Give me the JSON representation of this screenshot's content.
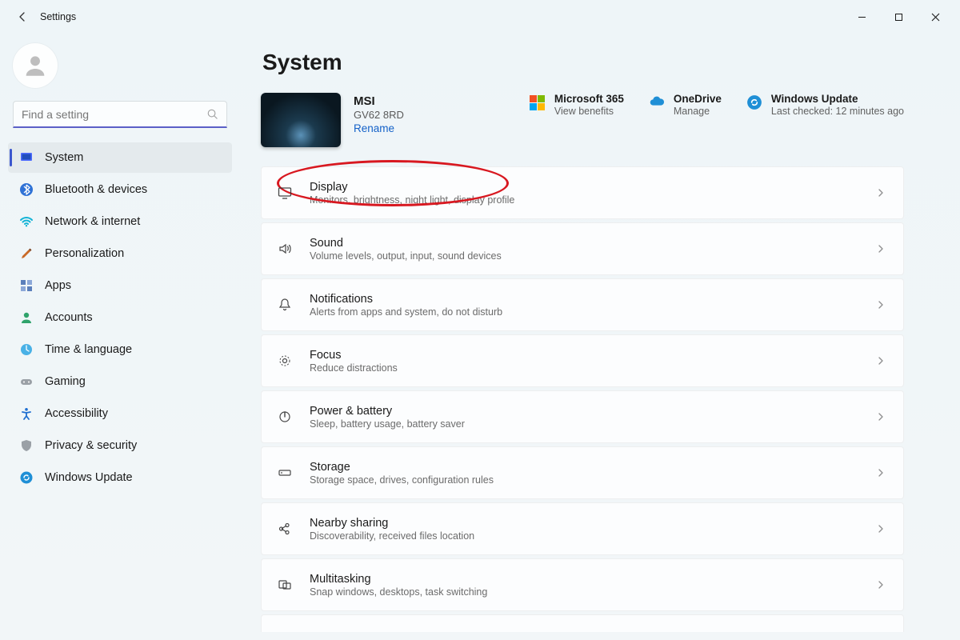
{
  "app_title": "Settings",
  "search": {
    "placeholder": "Find a setting"
  },
  "sidebar": {
    "items": [
      {
        "label": "System"
      },
      {
        "label": "Bluetooth & devices"
      },
      {
        "label": "Network & internet"
      },
      {
        "label": "Personalization"
      },
      {
        "label": "Apps"
      },
      {
        "label": "Accounts"
      },
      {
        "label": "Time & language"
      },
      {
        "label": "Gaming"
      },
      {
        "label": "Accessibility"
      },
      {
        "label": "Privacy & security"
      },
      {
        "label": "Windows Update"
      }
    ]
  },
  "page": {
    "title": "System",
    "device": {
      "name": "MSI",
      "model": "GV62 8RD",
      "rename": "Rename"
    },
    "status": [
      {
        "title": "Microsoft 365",
        "sub": "View benefits"
      },
      {
        "title": "OneDrive",
        "sub": "Manage"
      },
      {
        "title": "Windows Update",
        "sub": "Last checked: 12 minutes ago"
      }
    ],
    "settings": [
      {
        "title": "Display",
        "desc": "Monitors, brightness, night light, display profile"
      },
      {
        "title": "Sound",
        "desc": "Volume levels, output, input, sound devices"
      },
      {
        "title": "Notifications",
        "desc": "Alerts from apps and system, do not disturb"
      },
      {
        "title": "Focus",
        "desc": "Reduce distractions"
      },
      {
        "title": "Power & battery",
        "desc": "Sleep, battery usage, battery saver"
      },
      {
        "title": "Storage",
        "desc": "Storage space, drives, configuration rules"
      },
      {
        "title": "Nearby sharing",
        "desc": "Discoverability, received files location"
      },
      {
        "title": "Multitasking",
        "desc": "Snap windows, desktops, task switching"
      }
    ]
  }
}
